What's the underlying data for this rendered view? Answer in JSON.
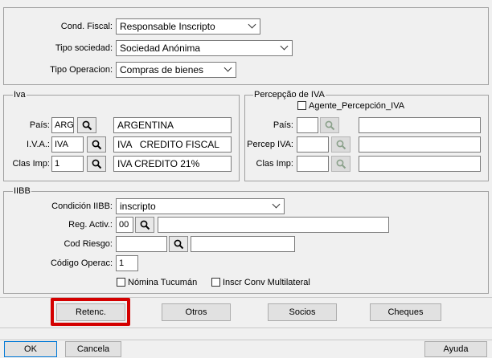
{
  "header": {
    "cond_fiscal_label": "Cond. Fiscal:",
    "cond_fiscal_value": "Responsable Inscripto",
    "tipo_sociedad_label": "Tipo sociedad:",
    "tipo_sociedad_value": "Sociedad Anónima",
    "tipo_operacion_label": "Tipo Operacion:",
    "tipo_operacion_value": "Compras de bienes"
  },
  "iva": {
    "legend": "Iva",
    "pais_label": "País:",
    "pais_code": "ARG",
    "pais_desc": "ARGENTINA",
    "iva_label": "I.V.A.:",
    "iva_code": "IVA",
    "iva_desc": "IVA   CREDITO FISCAL",
    "clas_label": "Clas Imp:",
    "clas_code": "1",
    "clas_desc": "IVA CREDITO 21%"
  },
  "percepcion": {
    "legend": "Percepção de IVA",
    "agente_label": "Agente_Percepción_IVA",
    "pais_label": "País:",
    "percep_label": "Percep IVA:",
    "clas_label": "Clas Imp:"
  },
  "iibb": {
    "legend": "IIBB",
    "condicion_label": "Condición IIBB:",
    "condicion_value": "inscripto",
    "reg_activ_label": "Reg. Activ.:",
    "reg_activ_value": "00",
    "cod_riesgo_label": "Cod Riesgo:",
    "codigo_operac_label": "Código Operac:",
    "codigo_operac_value": "1",
    "nomina_label": "Nómina Tucumán",
    "inscr_label": "Inscr Conv Multilateral"
  },
  "buttons": {
    "retenc": "Retenc.",
    "otros": "Otros",
    "socios": "Socios",
    "cheques": "Cheques"
  },
  "footer": {
    "ok": "OK",
    "cancela": "Cancela",
    "ayuda": "Ayuda"
  },
  "colors": {
    "highlight": "#d40000",
    "panel_bg": "#f0f0f0"
  }
}
